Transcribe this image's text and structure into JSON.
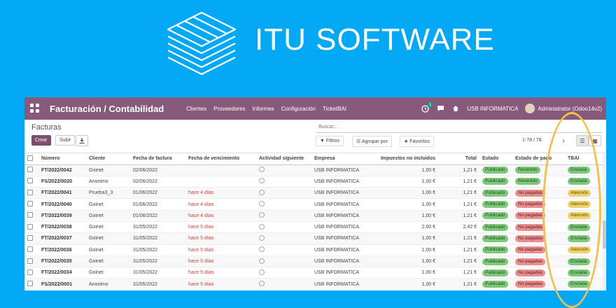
{
  "brand": {
    "name": "ITU SOFTWARE"
  },
  "navbar": {
    "app_title": "Facturación / Contabilidad",
    "menu": [
      "Clientes",
      "Proveedores",
      "Informes",
      "Configuración",
      "TicketBAI"
    ],
    "activity_badge": "1",
    "company": "USB INFORMATICA",
    "user": "Administrator (Odoo14v2)"
  },
  "control_panel": {
    "title": "Facturas",
    "create_label": "Crear",
    "upload_label": "Subir",
    "search_placeholder": "Buscar...",
    "filters_label": "Filtros",
    "group_by_label": "Agrupar por",
    "favorites_label": "Favoritos",
    "pager": "1-78 / 78"
  },
  "table": {
    "columns": [
      "Número",
      "Cliente",
      "Fecha de factura",
      "Fecha de vencimiento",
      "Actividad siguiente",
      "Empresa",
      "Impuestos no incluidos",
      "Total",
      "Estado",
      "Estado de pago",
      "TBAI"
    ],
    "rows": [
      {
        "numero": "FT/2022/0042",
        "cliente": "Goinet",
        "fecha": "02/06/2022",
        "vencimiento": "",
        "empresa": "USB INFORMATICA",
        "base": "1,00 €",
        "total": "1,21 €",
        "estado": "Publicado",
        "pago": "Revertido",
        "pago_color": "green",
        "tbai": "Enviada",
        "tbai_color": "green"
      },
      {
        "numero": "FS/2022/0020",
        "cliente": "Anonimo",
        "fecha": "02/06/2022",
        "vencimiento": "",
        "empresa": "USB INFORMATICA",
        "base": "1,00 €",
        "total": "1,21 €",
        "estado": "Publicado",
        "pago": "Revertido",
        "pago_color": "green",
        "tbai": "Enviada",
        "tbai_color": "green"
      },
      {
        "numero": "FT/2022/0041",
        "cliente": "Prueba3_3",
        "fecha": "01/06/2022",
        "vencimiento": "hace 4 días",
        "empresa": "USB INFORMATICA",
        "base": "1,00 €",
        "total": "1,21 €",
        "estado": "Publicado",
        "pago": "No pagadas",
        "pago_color": "red",
        "tbai": "Atención",
        "tbai_color": "yellow"
      },
      {
        "numero": "FT/2022/0040",
        "cliente": "Goinet",
        "fecha": "01/06/2022",
        "vencimiento": "hace 4 días",
        "empresa": "USB INFORMATICA",
        "base": "1,00 €",
        "total": "1,21 €",
        "estado": "Publicado",
        "pago": "No pagadas",
        "pago_color": "red",
        "tbai": "Atención",
        "tbai_color": "yellow"
      },
      {
        "numero": "FT/2022/0039",
        "cliente": "Goinet",
        "fecha": "01/06/2022",
        "vencimiento": "hace 4 días",
        "empresa": "USB INFORMATICA",
        "base": "1,00 €",
        "total": "1,21 €",
        "estado": "Publicado",
        "pago": "No pagadas",
        "pago_color": "red",
        "tbai": "Atención",
        "tbai_color": "yellow"
      },
      {
        "numero": "FT/2022/0038",
        "cliente": "Goinet",
        "fecha": "31/05/2022",
        "vencimiento": "hace 5 días",
        "empresa": "USB INFORMATICA",
        "base": "2,00 €",
        "total": "2,42 €",
        "estado": "Publicado",
        "pago": "No pagadas",
        "pago_color": "red",
        "tbai": "Enviada",
        "tbai_color": "green"
      },
      {
        "numero": "FT/2022/0037",
        "cliente": "Goinet",
        "fecha": "31/05/2022",
        "vencimiento": "hace 5 días",
        "empresa": "USB INFORMATICA",
        "base": "1,00 €",
        "total": "1,21 €",
        "estado": "Publicado",
        "pago": "No pagadas",
        "pago_color": "red",
        "tbai": "Enviada",
        "tbai_color": "green"
      },
      {
        "numero": "FT/2022/0036",
        "cliente": "Goinet",
        "fecha": "31/05/2022",
        "vencimiento": "hace 5 días",
        "empresa": "USB INFORMATICA",
        "base": "1,00 €",
        "total": "1,21 €",
        "estado": "Publicado",
        "pago": "No pagadas",
        "pago_color": "red",
        "tbai": "Atención",
        "tbai_color": "yellow"
      },
      {
        "numero": "FT/2022/0035",
        "cliente": "Goinet",
        "fecha": "31/05/2022",
        "vencimiento": "hace 5 días",
        "empresa": "USB INFORMATICA",
        "base": "1,00 €",
        "total": "1,21 €",
        "estado": "Publicado",
        "pago": "No pagadas",
        "pago_color": "red",
        "tbai": "Enviada",
        "tbai_color": "green"
      },
      {
        "numero": "FT/2022/0034",
        "cliente": "Goinet",
        "fecha": "31/05/2022",
        "vencimiento": "hace 5 días",
        "empresa": "USB INFORMATICA",
        "base": "1,00 €",
        "total": "1,21 €",
        "estado": "Publicado",
        "pago": "No pagadas",
        "pago_color": "red",
        "tbai": "Enviada",
        "tbai_color": "green"
      },
      {
        "numero": "FS/2022/0001",
        "cliente": "Anonimo",
        "fecha": "31/05/2022",
        "vencimiento": "hace 5 días",
        "empresa": "USB INFORMATICA",
        "base": "1,00 €",
        "total": "1,21 €",
        "estado": "Publicado",
        "pago": "No pagadas",
        "pago_color": "red",
        "tbai": "Enviada",
        "tbai_color": "green"
      }
    ]
  },
  "colors": {
    "background": "#03a9f4",
    "navbar": "#875a7b",
    "primary_button": "#7c4f6f",
    "overdue": "#d23f3a",
    "highlight": "#f5c04a"
  }
}
